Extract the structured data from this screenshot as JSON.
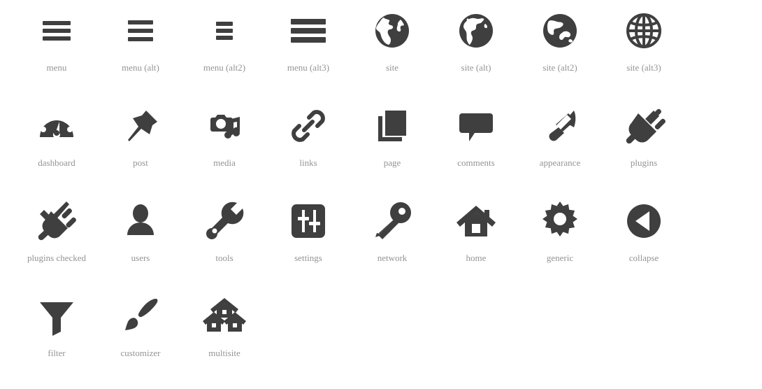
{
  "page": {
    "title": "Dashicons Reference Sheet",
    "background_color": "#ffffff",
    "icon_color": "#3f3f3f",
    "label_color": "#949494"
  },
  "grid": {
    "columns": 8,
    "rows": 4,
    "total_icons": 27
  },
  "icons": [
    {
      "name": "menu",
      "label": "menu",
      "icon": "menu-icon"
    },
    {
      "name": "menu-alt",
      "label": "menu (alt)",
      "icon": "menu-alt-icon"
    },
    {
      "name": "menu-alt2",
      "label": "menu (alt2)",
      "icon": "menu-alt2-icon"
    },
    {
      "name": "menu-alt3",
      "label": "menu (alt3)",
      "icon": "menu-alt3-icon"
    },
    {
      "name": "site",
      "label": "site",
      "icon": "globe-americas-icon"
    },
    {
      "name": "site-alt",
      "label": "site (alt)",
      "icon": "globe-africa-icon"
    },
    {
      "name": "site-alt2",
      "label": "site (alt2)",
      "icon": "globe-asia-icon"
    },
    {
      "name": "site-alt3",
      "label": "site (alt3)",
      "icon": "globe-wireframe-icon"
    },
    {
      "name": "dashboard",
      "label": "dashboard",
      "icon": "gauge-icon"
    },
    {
      "name": "post",
      "label": "post",
      "icon": "pushpin-icon"
    },
    {
      "name": "media",
      "label": "media",
      "icon": "camera-music-icon"
    },
    {
      "name": "links",
      "label": "links",
      "icon": "chain-link-icon"
    },
    {
      "name": "page",
      "label": "page",
      "icon": "pages-stack-icon"
    },
    {
      "name": "comments",
      "label": "comments",
      "icon": "speech-bubble-icon"
    },
    {
      "name": "appearance",
      "label": "appearance",
      "icon": "paintbrush-icon"
    },
    {
      "name": "plugins",
      "label": "plugins",
      "icon": "power-plug-icon"
    },
    {
      "name": "plugins-checked",
      "label": "plugins checked",
      "icon": "power-plug-check-icon"
    },
    {
      "name": "users",
      "label": "users",
      "icon": "user-icon"
    },
    {
      "name": "tools",
      "label": "tools",
      "icon": "wrench-icon"
    },
    {
      "name": "settings",
      "label": "settings",
      "icon": "sliders-icon"
    },
    {
      "name": "network",
      "label": "network",
      "icon": "key-icon"
    },
    {
      "name": "home",
      "label": "home",
      "icon": "house-icon"
    },
    {
      "name": "generic",
      "label": "generic",
      "icon": "gear-icon"
    },
    {
      "name": "collapse",
      "label": "collapse",
      "icon": "collapse-arrow-icon"
    },
    {
      "name": "filter",
      "label": "filter",
      "icon": "funnel-icon"
    },
    {
      "name": "customizer",
      "label": "customizer",
      "icon": "paint-stroke-icon"
    },
    {
      "name": "multisite",
      "label": "multisite",
      "icon": "multi-house-icon"
    }
  ]
}
